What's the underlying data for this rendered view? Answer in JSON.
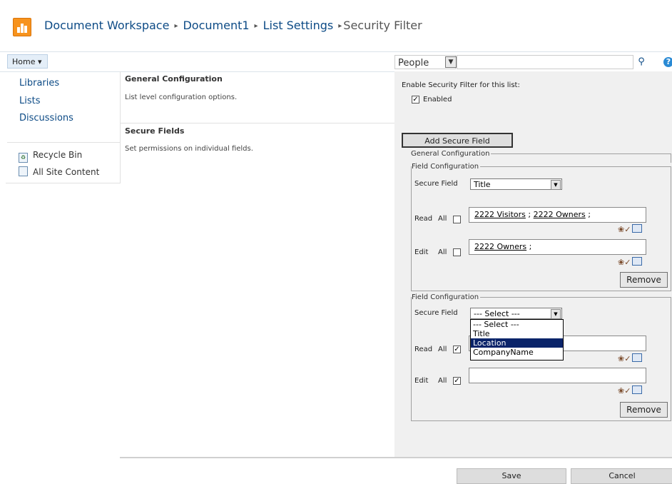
{
  "breadcrumb": {
    "items": [
      "Document Workspace",
      "Document1",
      "List Settings"
    ],
    "current": "Security Filter",
    "separator": "▸"
  },
  "topnav": {
    "home_label": "Home ▾",
    "scope_value": "People",
    "search_value": "",
    "search_icon": "magnifier-icon",
    "help_label": "?"
  },
  "leftnav": {
    "links": [
      "Libraries",
      "Lists",
      "Discussions"
    ],
    "recycle_bin": "Recycle Bin",
    "all_site_content": "All Site Content"
  },
  "main": {
    "general": {
      "title": "General Configuration",
      "desc": "List level configuration options."
    },
    "secure": {
      "title": "Secure Fields",
      "desc": "Set permissions on individual fields."
    }
  },
  "panel": {
    "enable_label": "Enable Security Filter for this list:",
    "enabled_label": "Enabled",
    "enabled_checked": true,
    "add_button": "Add Secure Field",
    "general_legend": "General Configuration",
    "field_legend": "Field Configuration",
    "secure_field_label": "Secure Field",
    "read_label": "Read",
    "edit_label": "Edit",
    "all_label": "All",
    "remove_label": "Remove",
    "field1": {
      "secure_field_value": "Title",
      "read_all_checked": false,
      "edit_all_checked": false,
      "read_people": [
        "2222 Visitors",
        "2222 Owners"
      ],
      "edit_people": [
        "2222 Owners"
      ]
    },
    "field2": {
      "secure_field_value": "--- Select ---",
      "read_all_checked": true,
      "edit_all_checked": true,
      "dropdown_options": [
        "--- Select ---",
        "Title",
        "Location",
        "CompanyName"
      ],
      "highlighted_option": "Location"
    }
  },
  "footer": {
    "save_label": "Save",
    "cancel_label": "Cancel"
  },
  "colors": {
    "link": "#0d4b86",
    "panel_bg": "#f0f0f0",
    "logo": "#f7931d",
    "highlight": "#0a246a"
  }
}
